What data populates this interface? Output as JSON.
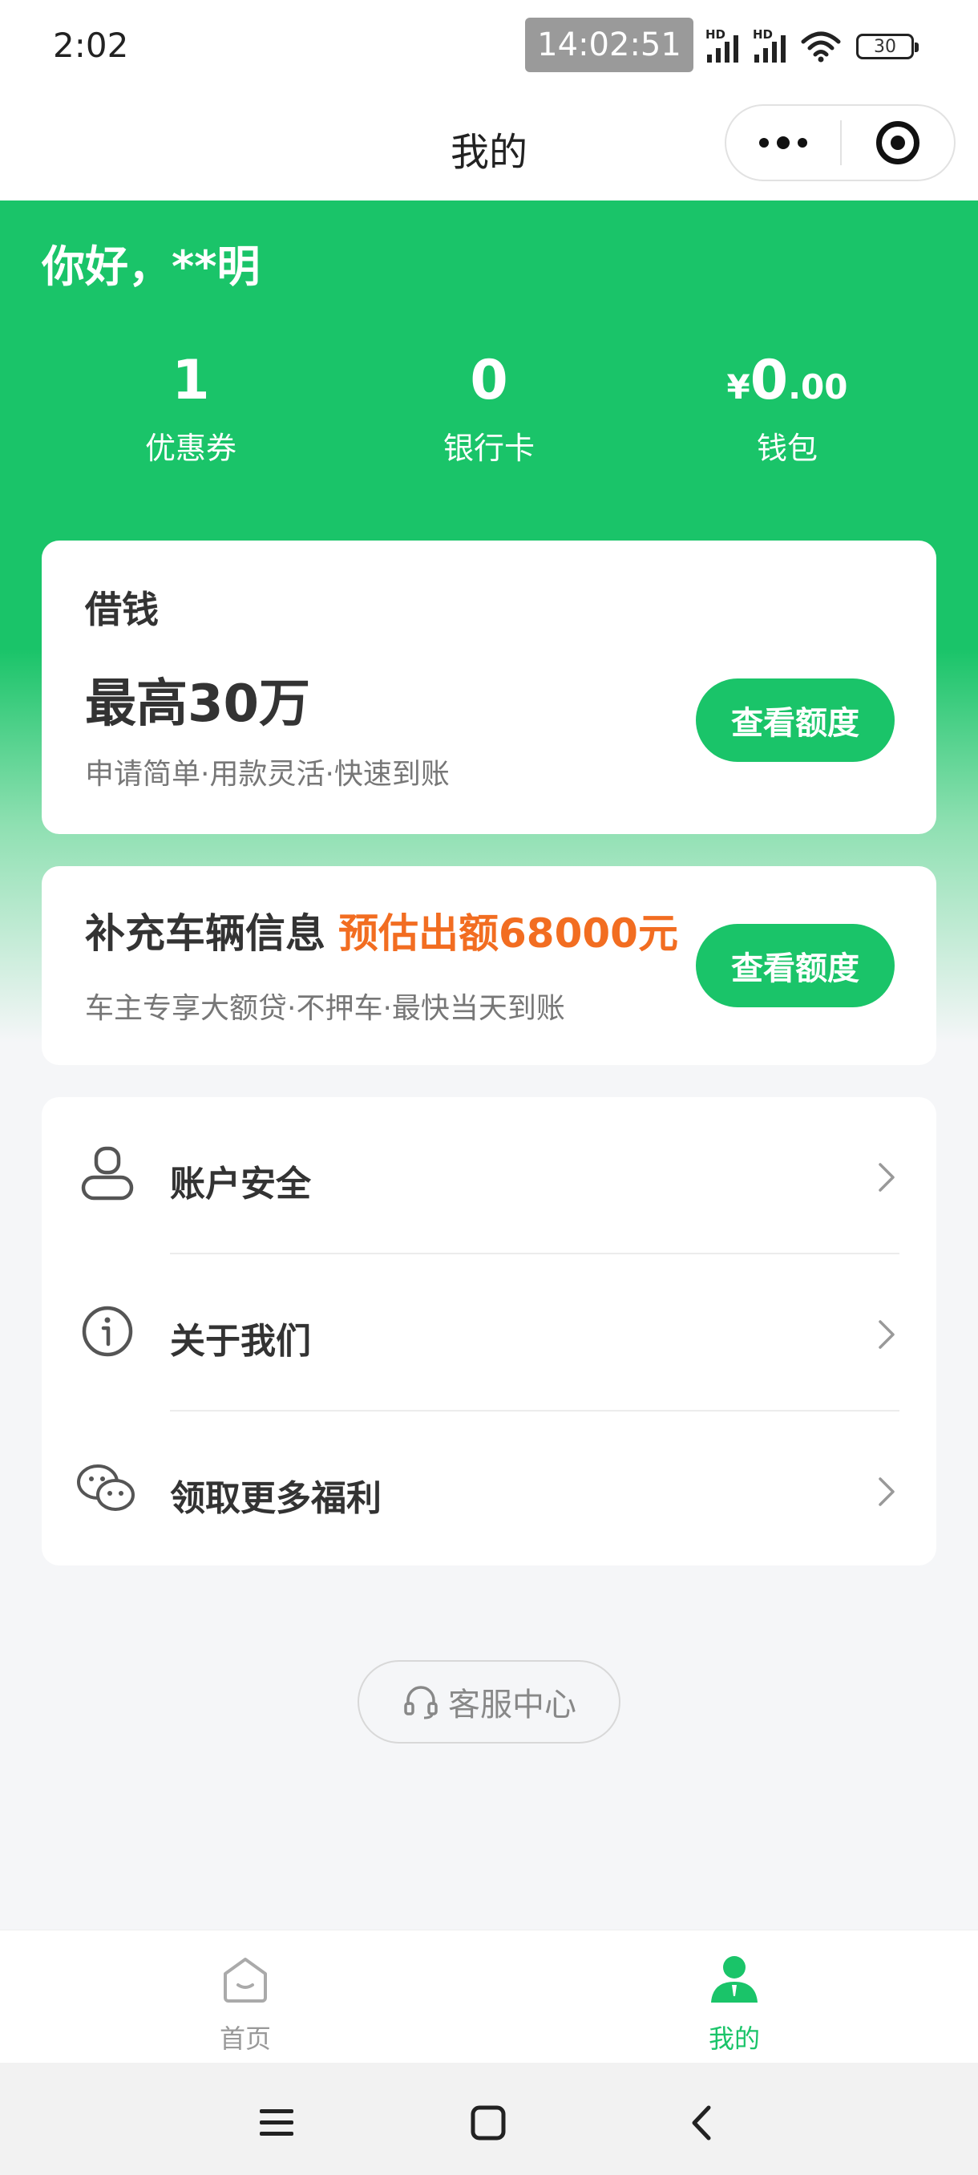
{
  "status_bar": {
    "time": "2:02",
    "clock_overlay": "14:02:51",
    "signal_label_1": "HD",
    "signal_label_2": "HD",
    "battery": "30"
  },
  "nav": {
    "title": "我的"
  },
  "hero": {
    "greeting": "你好，**明",
    "stats": [
      {
        "value": "1",
        "label": "优惠券"
      },
      {
        "value": "0",
        "label": "银行卡"
      },
      {
        "currency": "¥",
        "value": "0",
        "decimals": ".00",
        "label": "钱包"
      }
    ]
  },
  "loan_card": {
    "title": "借钱",
    "amount": "最高30万",
    "subtitle": "申请简单·用款灵活·快速到账",
    "button": "查看额度"
  },
  "car_card": {
    "title": "补充车辆信息",
    "highlight": "预估出额68000元",
    "subtitle": "车主专享大额贷·不押车·最快当天到账",
    "button": "查看额度"
  },
  "menu": [
    {
      "label": "账户安全",
      "icon": "user-icon"
    },
    {
      "label": "关于我们",
      "icon": "info-icon"
    },
    {
      "label": "领取更多福利",
      "icon": "wechat-icon"
    }
  ],
  "service": {
    "label": "客服中心",
    "icon": "headset-icon"
  },
  "tabbar": {
    "items": [
      {
        "label": "首页",
        "icon": "home-icon",
        "active": false
      },
      {
        "label": "我的",
        "icon": "person-icon",
        "active": true
      }
    ]
  },
  "colors": {
    "brand_green": "#1ac469",
    "highlight_orange": "#f26d21",
    "background": "#f5f6f8"
  }
}
